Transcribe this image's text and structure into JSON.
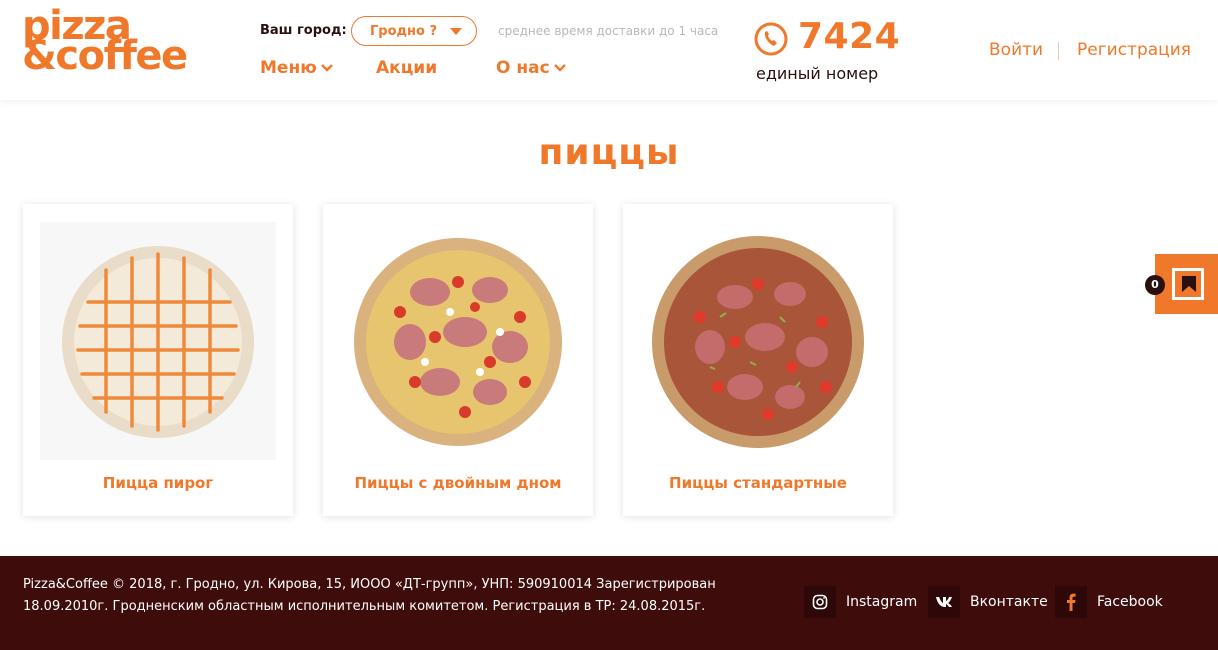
{
  "header": {
    "logo_line1": "pizza",
    "logo_line2": "&coffee",
    "city_label": "Ваш город:",
    "city_value": "Гродно ?",
    "delivery_note": "среднее время доставки до 1 часа",
    "nav": {
      "menu": "Меню",
      "promos": "Акции",
      "about": "О нас"
    },
    "phone_number": "7424",
    "phone_caption": "единый номер",
    "login": "Войти",
    "register": "Регистрация"
  },
  "main": {
    "title": "пиццы",
    "cards": [
      {
        "label": "Пицца пирог",
        "image": "pie-pizza-photo"
      },
      {
        "label": "Пиццы с двойным дном",
        "image": "double-crust-pizza-photo"
      },
      {
        "label": "Пиццы стандартные",
        "image": "standard-pizza-photo"
      }
    ]
  },
  "cart": {
    "count": "0",
    "icon": "bookmark-flag-icon"
  },
  "footer": {
    "line1": "Pizza&Coffee © 2018, г. Гродно, ул. Кирова, 15, ИООО «ДТ-групп», УНП: 590910014 Зарегистрирован",
    "line2": "18.09.2010г. Гродненским областным исполнительным комитетом. Регистрация в ТР: 24.08.2015г.",
    "social": [
      {
        "label": "Instagram",
        "icon": "instagram-icon"
      },
      {
        "label": "Вконтакте",
        "icon": "vk-icon"
      },
      {
        "label": "Facebook",
        "icon": "facebook-icon"
      }
    ]
  },
  "colors": {
    "accent": "#f0782b",
    "dark": "#2a0f0f",
    "footer_bg": "#3f0c0c"
  }
}
